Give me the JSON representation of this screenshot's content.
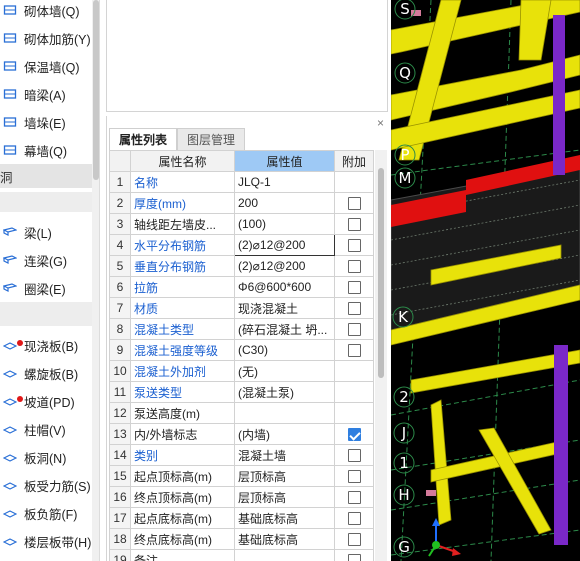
{
  "left_panel": {
    "items_top": [
      {
        "label": "砌体墙(Q)",
        "icon": "masonry-wall-icon"
      },
      {
        "label": "砌体加筋(Y)",
        "icon": "masonry-rebar-icon"
      },
      {
        "label": "保温墙(Q)",
        "icon": "insulation-wall-icon"
      },
      {
        "label": "暗梁(A)",
        "icon": "hidden-beam-icon"
      },
      {
        "label": "墙垛(E)",
        "icon": "wall-pier-icon"
      },
      {
        "label": "幕墙(Q)",
        "icon": "curtain-wall-icon"
      }
    ],
    "category_1": "洞",
    "items_mid": [
      {
        "label": "梁(L)",
        "icon": "beam-icon"
      },
      {
        "label": "连梁(G)",
        "icon": "coupling-beam-icon"
      },
      {
        "label": "圈梁(E)",
        "icon": "ring-beam-icon"
      }
    ],
    "items_bottom": [
      {
        "label": "现浇板(B)",
        "icon": "cast-slab-icon",
        "dot": true
      },
      {
        "label": "螺旋板(B)",
        "icon": "spiral-slab-icon",
        "dot": false
      },
      {
        "label": "坡道(PD)",
        "icon": "ramp-icon",
        "dot": true
      },
      {
        "label": "柱帽(V)",
        "icon": "column-cap-icon",
        "dot": false
      },
      {
        "label": "板洞(N)",
        "icon": "slab-hole-icon",
        "dot": false
      },
      {
        "label": "板受力筋(S)",
        "icon": "slab-main-rebar-icon",
        "dot": false
      },
      {
        "label": "板负筋(F)",
        "icon": "slab-negative-rebar-icon",
        "dot": false
      },
      {
        "label": "楼层板带(H)",
        "icon": "floor-strip-icon",
        "dot": false
      }
    ]
  },
  "property_panel": {
    "close": "×",
    "tabs": [
      "属性列表",
      "图层管理"
    ],
    "headers": [
      "属性名称",
      "属性值",
      "附加"
    ],
    "rows": [
      {
        "no": "1",
        "name": "名称",
        "value": "JLQ-1",
        "blue": true,
        "check": null
      },
      {
        "no": "2",
        "name": "厚度(mm)",
        "value": "200",
        "blue": true,
        "check": false
      },
      {
        "no": "3",
        "name": "轴线距左墙皮...",
        "value": "(100)",
        "blue": false,
        "check": false
      },
      {
        "no": "4",
        "name": "水平分布钢筋",
        "value": "(2)⌀12@200",
        "blue": true,
        "check": false,
        "selected": true
      },
      {
        "no": "5",
        "name": "垂直分布钢筋",
        "value": "(2)⌀12@200",
        "blue": true,
        "check": false
      },
      {
        "no": "6",
        "name": "拉筋",
        "value": "Φ6@600*600",
        "blue": true,
        "check": false
      },
      {
        "no": "7",
        "name": "材质",
        "value": "现浇混凝土",
        "blue": true,
        "check": false
      },
      {
        "no": "8",
        "name": "混凝土类型",
        "value": "(碎石混凝土 坍...",
        "blue": true,
        "check": false
      },
      {
        "no": "9",
        "name": "混凝土强度等级",
        "value": "(C30)",
        "blue": true,
        "check": false
      },
      {
        "no": "10",
        "name": "混凝土外加剂",
        "value": "(无)",
        "blue": true,
        "check": null
      },
      {
        "no": "11",
        "name": "泵送类型",
        "value": "(混凝土泵)",
        "blue": true,
        "check": null
      },
      {
        "no": "12",
        "name": "泵送高度(m)",
        "value": "",
        "blue": false,
        "check": null
      },
      {
        "no": "13",
        "name": "内/外墙标志",
        "value": "(内墙)",
        "blue": false,
        "check": true
      },
      {
        "no": "14",
        "name": "类别",
        "value": "混凝土墙",
        "blue": true,
        "check": false
      },
      {
        "no": "15",
        "name": "起点顶标高(m)",
        "value": "层顶标高",
        "blue": false,
        "check": false
      },
      {
        "no": "16",
        "name": "终点顶标高(m)",
        "value": "层顶标高",
        "blue": false,
        "check": false
      },
      {
        "no": "17",
        "name": "起点底标高(m)",
        "value": "基础底标高",
        "blue": false,
        "check": false
      },
      {
        "no": "18",
        "name": "终点底标高(m)",
        "value": "基础底标高",
        "blue": false,
        "check": false
      },
      {
        "no": "19",
        "name": "备注",
        "value": "",
        "blue": false,
        "check": false
      }
    ]
  },
  "viewport": {
    "axis_labels": [
      "S",
      "Q",
      "P",
      "M",
      "K",
      "2",
      "J",
      "1",
      "H",
      "G"
    ],
    "axes": [
      "z",
      "x",
      "y"
    ]
  }
}
